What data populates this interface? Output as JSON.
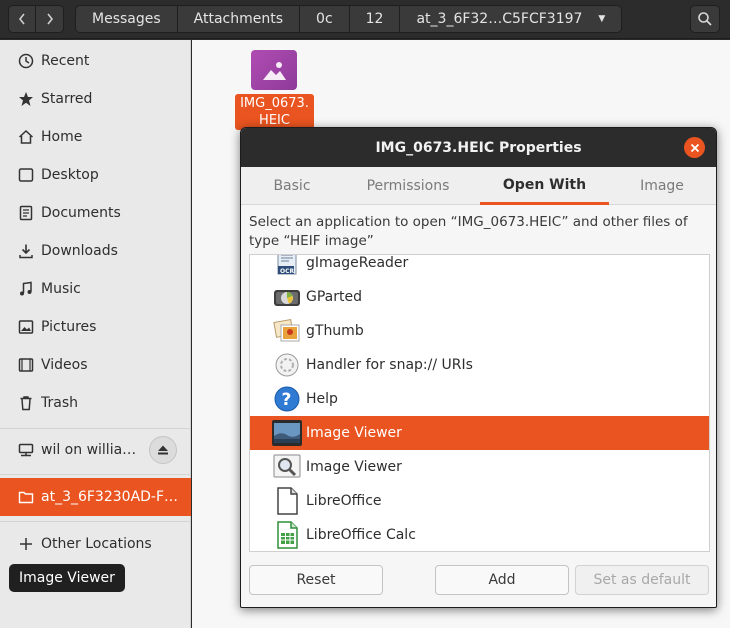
{
  "pathbar": {
    "crumbs": [
      "Messages",
      "Attachments",
      "0c",
      "12",
      "at_3_6F32…C5FCF3197"
    ]
  },
  "sidebar": {
    "items": [
      {
        "label": "Recent",
        "icon": "clock-icon"
      },
      {
        "label": "Starred",
        "icon": "star-icon"
      },
      {
        "label": "Home",
        "icon": "home-icon"
      },
      {
        "label": "Desktop",
        "icon": "desktop-icon"
      },
      {
        "label": "Documents",
        "icon": "document-icon"
      },
      {
        "label": "Downloads",
        "icon": "download-icon"
      },
      {
        "label": "Music",
        "icon": "music-icon"
      },
      {
        "label": "Pictures",
        "icon": "pictures-icon"
      },
      {
        "label": "Videos",
        "icon": "videos-icon"
      },
      {
        "label": "Trash",
        "icon": "trash-icon"
      }
    ],
    "network_mount": "wil on willia…",
    "current_folder": "at_3_6F3230AD-F…",
    "other_locations": "Other Locations"
  },
  "tooltip": "Image Viewer",
  "file": {
    "name": "IMG_0673.\nHEIC"
  },
  "dialog": {
    "title": "IMG_0673.HEIC Properties",
    "tabs": [
      "Basic",
      "Permissions",
      "Open With",
      "Image"
    ],
    "active_tab": "Open With",
    "description": "Select an application to open “IMG_0673.HEIC” and other files of type “HEIF image”",
    "apps": [
      {
        "name": "gImageReader",
        "icon": "ocr-icon"
      },
      {
        "name": "GParted",
        "icon": "disk-partition-icon"
      },
      {
        "name": "gThumb",
        "icon": "photos-icon"
      },
      {
        "name": "Handler for snap:// URIs",
        "icon": "snap-handler-icon"
      },
      {
        "name": "Help",
        "icon": "help-icon"
      },
      {
        "name": "Image Viewer",
        "icon": "image-viewer-icon",
        "selected": true
      },
      {
        "name": "Image Viewer",
        "icon": "magnifier-image-icon"
      },
      {
        "name": "LibreOffice",
        "icon": "libreoffice-icon"
      },
      {
        "name": "LibreOffice Calc",
        "icon": "libreoffice-calc-icon"
      }
    ],
    "buttons": {
      "reset": "Reset",
      "add": "Add",
      "set_default": "Set as default"
    }
  },
  "colors": {
    "accent": "#e95420",
    "headerbar": "#2c2c2c",
    "sidebar": "#e9e9e9"
  }
}
